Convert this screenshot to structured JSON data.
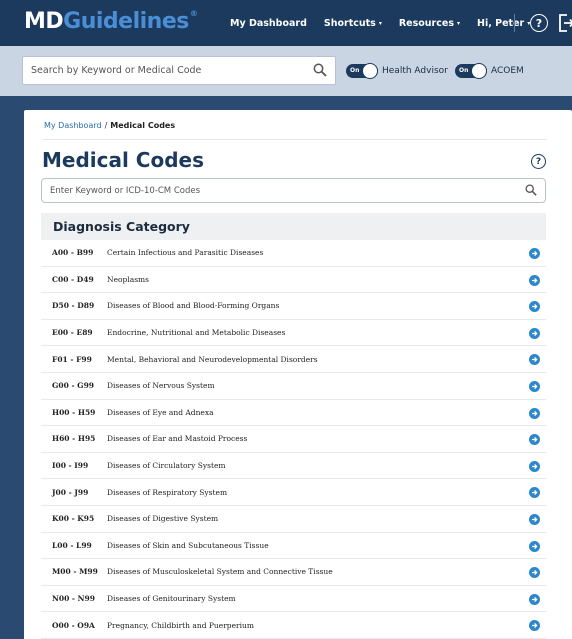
{
  "brand": {
    "md": "MD",
    "guidelines": "Guidelines",
    "reg": "®"
  },
  "nav": {
    "items": [
      {
        "label": "My Dashboard",
        "caret": ""
      },
      {
        "label": "Shortcuts",
        "caret": "▾"
      },
      {
        "label": "Resources",
        "caret": "▾"
      },
      {
        "label": "Hi, Peter",
        "caret": "▾"
      }
    ],
    "help_glyph": "?"
  },
  "search": {
    "placeholder": "Search by Keyword or Medical Code",
    "toggles": [
      {
        "state": "On",
        "label": "Health Advisor"
      },
      {
        "state": "On",
        "label": "ACOEM"
      }
    ]
  },
  "breadcrumb": {
    "root": "My Dashboard",
    "separator": "/",
    "current": "Medical Codes"
  },
  "page": {
    "title": "Medical Codes",
    "help_glyph": "?",
    "code_search_placeholder": "Enter Keyword or ICD-10-CM Codes"
  },
  "table": {
    "heading": "Diagnosis Category",
    "rows": [
      {
        "code": "A00 - B99",
        "desc": "Certain Infectious and Parasitic Diseases"
      },
      {
        "code": "C00 - D49",
        "desc": "Neoplasms"
      },
      {
        "code": "D50 - D89",
        "desc": "Diseases of Blood and Blood-Forming Organs"
      },
      {
        "code": "E00 - E89",
        "desc": "Endocrine, Nutritional and Metabolic Diseases"
      },
      {
        "code": "F01 - F99",
        "desc": "Mental, Behavioral and Neurodevelopmental Disorders"
      },
      {
        "code": "G00 - G99",
        "desc": "Diseases of Nervous System"
      },
      {
        "code": "H00 - H59",
        "desc": "Diseases of Eye and Adnexa"
      },
      {
        "code": "H60 - H95",
        "desc": "Diseases of Ear and Mastoid Process"
      },
      {
        "code": "I00 - I99",
        "desc": "Diseases of Circulatory System"
      },
      {
        "code": "J00 - J99",
        "desc": "Diseases of Respiratory System"
      },
      {
        "code": "K00 - K95",
        "desc": "Diseases of Digestive System"
      },
      {
        "code": "L00 - L99",
        "desc": "Diseases of Skin and Subcutaneous Tissue"
      },
      {
        "code": "M00 - M99",
        "desc": "Diseases of Musculoskeletal System and Connective Tissue"
      },
      {
        "code": "N00 - N99",
        "desc": "Diseases of Genitourinary System"
      },
      {
        "code": "O00 - O9A",
        "desc": "Pregnancy, Childbirth and Puerperium"
      }
    ]
  },
  "colors": {
    "nav_bg": "#1c3a5e",
    "accent_blue": "#4a8fd6",
    "search_row_bg": "#c9d5e2",
    "page_bg": "#2b4a72",
    "row_go": "#2e87c9"
  }
}
